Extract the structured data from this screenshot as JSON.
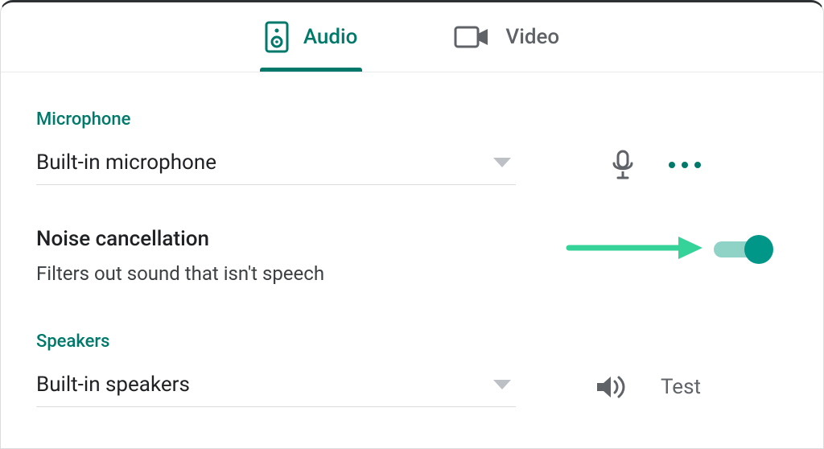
{
  "accent_color": "#00796b",
  "tabs": {
    "audio": {
      "label": "Audio",
      "active": true
    },
    "video": {
      "label": "Video",
      "active": false
    }
  },
  "microphone": {
    "section_title": "Microphone",
    "selected": "Built-in microphone"
  },
  "noise_cancellation": {
    "title": "Noise cancellation",
    "description": "Filters out sound that isn't speech",
    "enabled": true
  },
  "speakers": {
    "section_title": "Speakers",
    "selected": "Built-in speakers",
    "test_label": "Test"
  }
}
